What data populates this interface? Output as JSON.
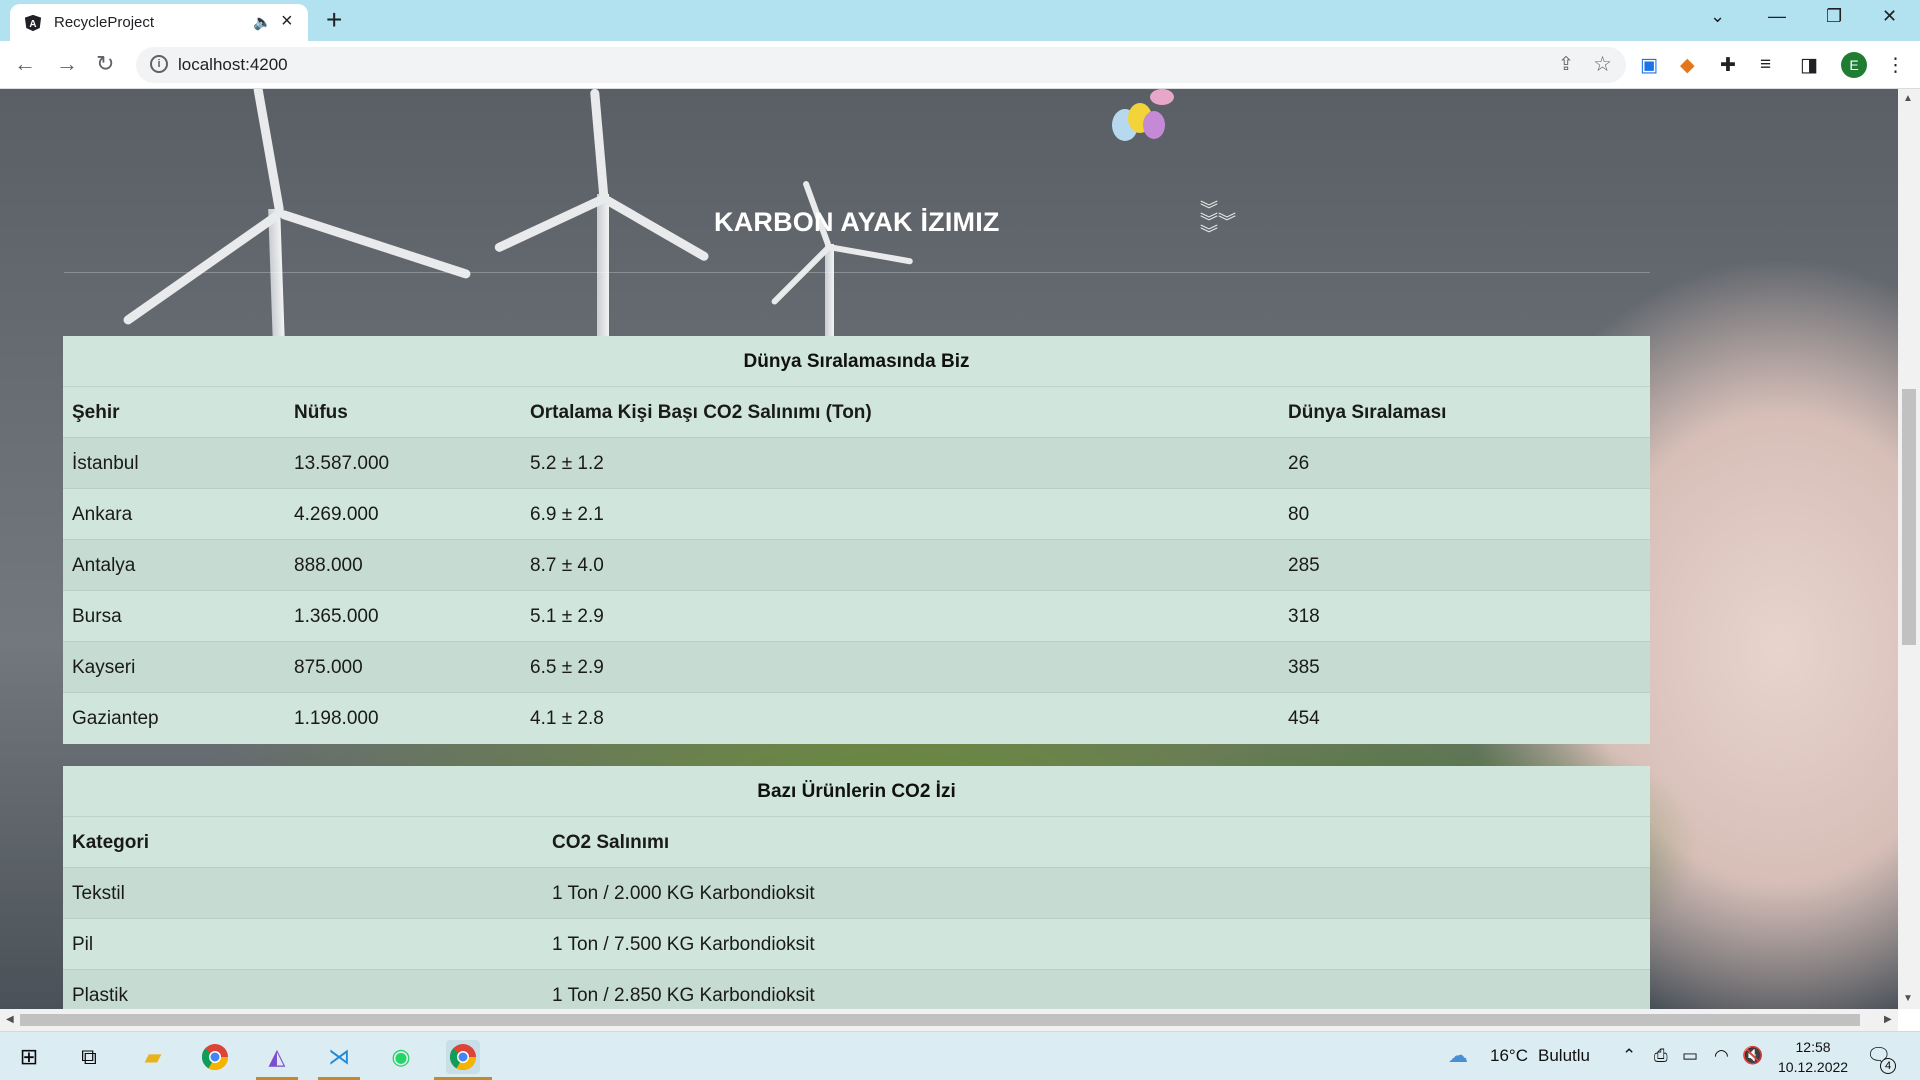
{
  "browser": {
    "tab_title": "RecycleProject",
    "url": "localhost:4200",
    "profile_initial": "E"
  },
  "page": {
    "heading": "KARBON AYAK İZIMIZ"
  },
  "ranking_table": {
    "caption": "Dünya Sıralamasında Biz",
    "headers": [
      "Şehir",
      "Nüfus",
      "Ortalama Kişi Başı CO2 Salınımı (Ton)",
      "Dünya Sıralaması"
    ],
    "rows": [
      [
        "İstanbul",
        "13.587.000",
        "5.2 ± 1.2",
        "26"
      ],
      [
        "Ankara",
        "4.269.000",
        "6.9 ± 2.1",
        "80"
      ],
      [
        "Antalya",
        "888.000",
        "8.7 ± 4.0",
        "285"
      ],
      [
        "Bursa",
        "1.365.000",
        "5.1 ± 2.9",
        "318"
      ],
      [
        "Kayseri",
        "875.000",
        "6.5 ± 2.9",
        "385"
      ],
      [
        "Gaziantep",
        "1.198.000",
        "4.1 ± 2.8",
        "454"
      ]
    ]
  },
  "products_table": {
    "caption": "Bazı Ürünlerin CO2 İzi",
    "headers": [
      "Kategori",
      "CO2 Salınımı"
    ],
    "rows": [
      [
        "Tekstil",
        "1 Ton / 2.000 KG Karbondioksit"
      ],
      [
        "Pil",
        "1 Ton / 7.500 KG Karbondioksit"
      ],
      [
        "Plastik",
        "1 Ton / 2.850 KG Karbondioksit"
      ]
    ]
  },
  "taskbar": {
    "weather_temp": "16°C",
    "weather_text": "Bulutlu",
    "time": "12:58",
    "date": "10.12.2022",
    "notification_count": "4"
  }
}
